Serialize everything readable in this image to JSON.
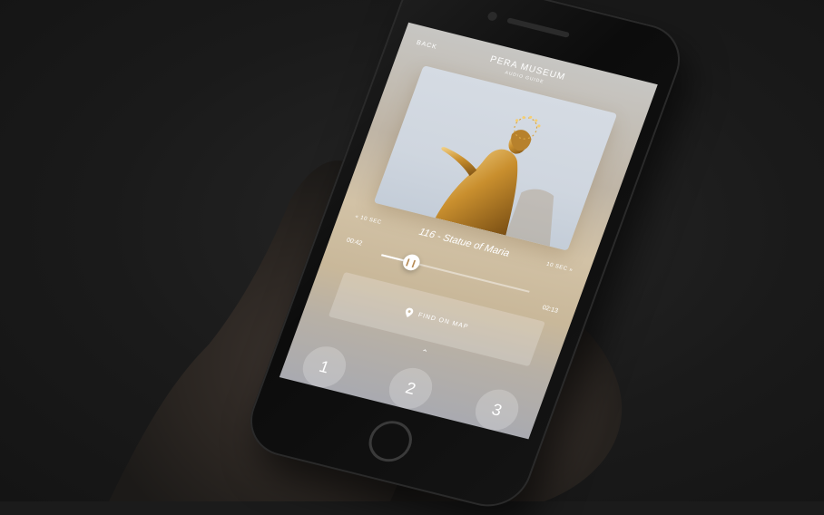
{
  "header": {
    "back_label": "BACK",
    "title": "PERA MUSEUM",
    "subtitle": "AUDIO GUIDE"
  },
  "player": {
    "skip_back_label": "10 SEC",
    "track_title": "116 - Statue of Maria",
    "skip_forward_label": "10 SEC",
    "time_elapsed": "00:42",
    "time_total": "02:13",
    "progress": 0.2
  },
  "actions": {
    "find_on_map_label": "FIND ON MAP"
  },
  "keypad": {
    "keys": [
      "1",
      "2",
      "3"
    ]
  },
  "colors": {
    "background": "#1b1b1b",
    "accent_gold": "#c9a066",
    "text": "#ffffff"
  },
  "icons": {
    "back": "chevron-left-icon",
    "skip_back": "rewind-icon",
    "skip_forward": "fast-forward-icon",
    "pause": "pause-icon",
    "map_pin": "map-pin-icon",
    "expand": "chevron-up-icon"
  }
}
